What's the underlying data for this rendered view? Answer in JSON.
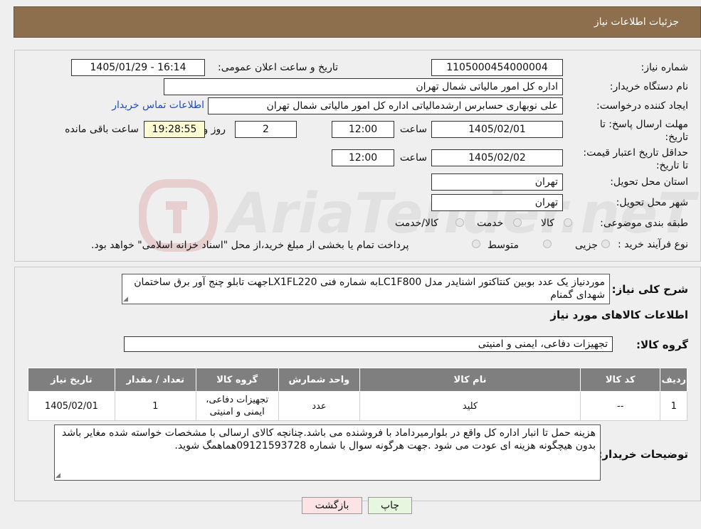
{
  "header": {
    "title": "جزئیات اطلاعات نیاز"
  },
  "form": {
    "need_number_label": "شماره نیاز:",
    "need_number": "1105000454000004",
    "announce_label": "تاریخ و ساعت اعلان عمومی:",
    "announce_value": "1405/01/29 - 16:14",
    "buyer_org_label": "نام دستگاه خریدار:",
    "buyer_org": "اداره کل امور مالیاتی شمال تهران",
    "requester_label": "ایجاد کننده درخواست:",
    "requester": "علی نوبهاری حسابرس ارشدمالیاتی اداره کل امور مالیاتی شمال تهران",
    "contact_link": "اطلاعات تماس خریدار",
    "deadline_label": "مهلت ارسال پاسخ: تا تاریخ:",
    "deadline_date": "1405/02/01",
    "time_label": "ساعت",
    "deadline_time": "12:00",
    "days": "2",
    "days_label": "روز و",
    "remaining_time": "19:28:55",
    "remaining_label": "ساعت باقی مانده",
    "validity_label": "حداقل تاریخ اعتبار قیمت: تا تاریخ:",
    "validity_date": "1405/02/02",
    "validity_time": "12:00",
    "province_label": "استان محل تحویل:",
    "province": "تهران",
    "city_label": "شهر محل تحویل:",
    "city": "تهران",
    "category_label": "طبقه بندی موضوعی:",
    "category_options": [
      "کالا",
      "خدمت",
      "کالا/خدمت"
    ],
    "process_label": "نوع فرآیند خرید :",
    "process_options": [
      "جزیی",
      "متوسط"
    ],
    "process_note": "پرداخت تمام یا بخشی از مبلغ خرید،از محل \"اسناد خزانه اسلامی\" خواهد بود."
  },
  "description": {
    "label": "شرح کلی نیاز:",
    "text": "موردنیاز یک عدد بوبین کنتاکتور اشنایدر مدل LC1F800به شماره فنی LX1FL220جهت تابلو چنج آور برق ساختمان شهدای گمنام"
  },
  "goods": {
    "section_title": "اطلاعات کالاهای مورد نیاز",
    "group_label": "گروه کالا:",
    "group_value": "تجهیزات دفاعی، ایمنی و امنیتی",
    "columns": [
      "ردیف",
      "کد کالا",
      "نام کالا",
      "واحد شمارش",
      "گروه کالا",
      "تعداد / مقدار",
      "تاریخ نیاز"
    ],
    "rows": [
      {
        "row": "1",
        "code": "--",
        "name": "کلید",
        "unit": "عدد",
        "group": "تجهیزات دفاعی، ایمنی و امنیتی",
        "qty": "1",
        "date": "1405/02/01"
      }
    ]
  },
  "buyer_notes": {
    "label": "توضیحات خریدار:",
    "text": "هزینه حمل تا انبار اداره کل واقع در بلوارمیرداماد با فروشنده می باشد.چنانچه کالای ارسالی با مشخصات خواسته شده مغایر باشد بدون هیچگونه هزینه ای عودت می شود .جهت هرگونه سوال با شماره 09121593728هماهمگ شوید."
  },
  "buttons": {
    "print": "چاپ",
    "back": "بازگشت"
  },
  "watermark": {
    "text": "AriaTender.neT"
  },
  "colors": {
    "header_bg": "#8e6f4d",
    "table_header_bg": "#7f7f7f",
    "back_button_bg": "#fde3e3",
    "print_button_bg": "#e7f7df",
    "timer_bg": "#fdfbd2",
    "link": "#1a4fc4"
  }
}
